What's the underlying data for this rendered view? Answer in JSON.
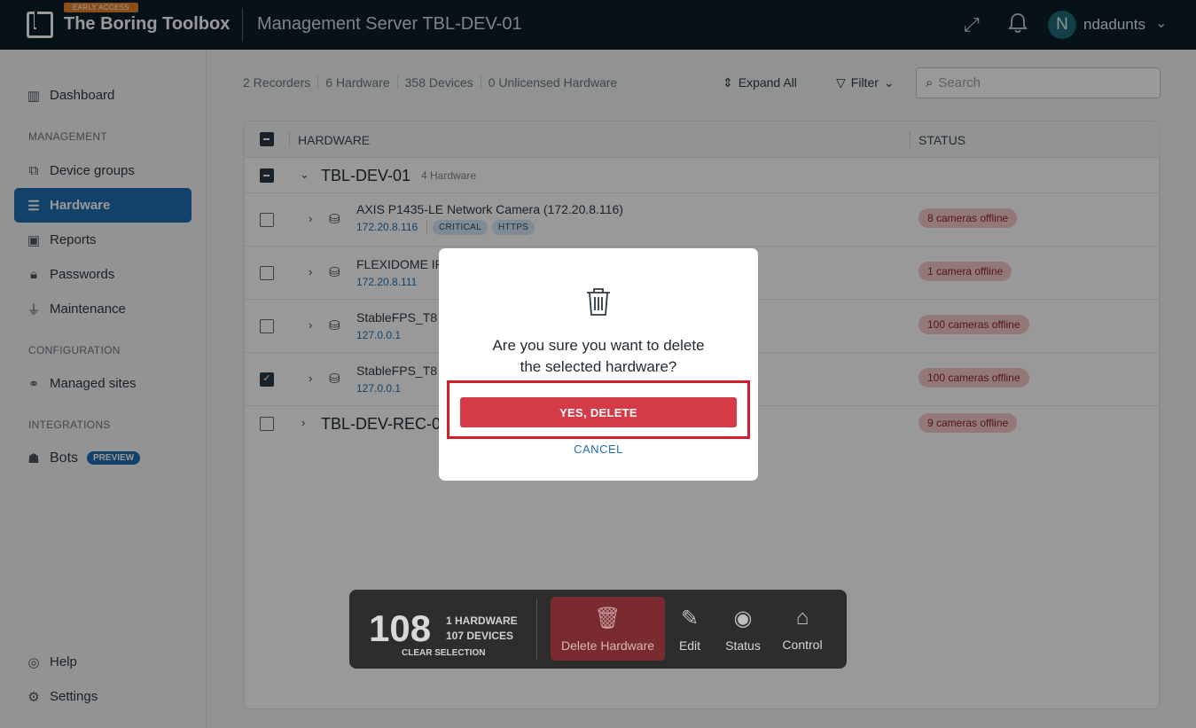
{
  "header": {
    "badge": "EARLY ACCESS",
    "app_title": "The Boring Toolbox",
    "server_title": "Management Server TBL-DEV-01",
    "user_initial": "N",
    "username": "ndadunts"
  },
  "sidebar": {
    "dashboard": "Dashboard",
    "section_management": "MANAGEMENT",
    "device_groups": "Device groups",
    "hardware": "Hardware",
    "reports": "Reports",
    "passwords": "Passwords",
    "maintenance": "Maintenance",
    "section_configuration": "CONFIGURATION",
    "managed_sites": "Managed sites",
    "section_integrations": "INTEGRATIONS",
    "bots": "Bots",
    "bots_badge": "PREVIEW",
    "help": "Help",
    "settings": "Settings"
  },
  "toolbar": {
    "recorders": "2 Recorders",
    "hardware": "6 Hardware",
    "devices": "358 Devices",
    "unlicensed": "0 Unlicensed Hardware",
    "expand_all": "Expand All",
    "filter": "Filter",
    "search_placeholder": "Search"
  },
  "table": {
    "col_hardware": "HARDWARE",
    "col_status": "STATUS",
    "group1_name": "TBL-DEV-01",
    "group1_count": "4 Hardware",
    "rows": [
      {
        "name": "AXIS P1435-LE Network Camera (172.20.8.116)",
        "ip": "172.20.8.116",
        "tag1": "CRITICAL",
        "tag2": "HTTPS",
        "status": "8 cameras offline"
      },
      {
        "name": "FLEXIDOME IP",
        "ip": "172.20.8.111",
        "status": "1 camera offline"
      },
      {
        "name": "StableFPS_T8",
        "ip": "127.0.0.1",
        "status": "100 cameras offline"
      },
      {
        "name": "StableFPS_T8",
        "ip": "127.0.0.1",
        "status": "100 cameras offline"
      }
    ],
    "group2_name": "TBL-DEV-REC-0",
    "group2_status": "9 cameras offline"
  },
  "actionbar": {
    "count": "108",
    "hardware_count": "1 HARDWARE",
    "devices_count": "107 DEVICES",
    "clear": "CLEAR SELECTION",
    "delete": "Delete Hardware",
    "edit": "Edit",
    "status": "Status",
    "control": "Control"
  },
  "dialog": {
    "line1": "Are you sure you want to delete",
    "line2": "the selected hardware?",
    "confirm": "YES, DELETE",
    "cancel": "CANCEL"
  },
  "colors": {
    "topbar": "#0d1d28",
    "accent": "#1f6fb0",
    "danger": "#d43b47"
  }
}
